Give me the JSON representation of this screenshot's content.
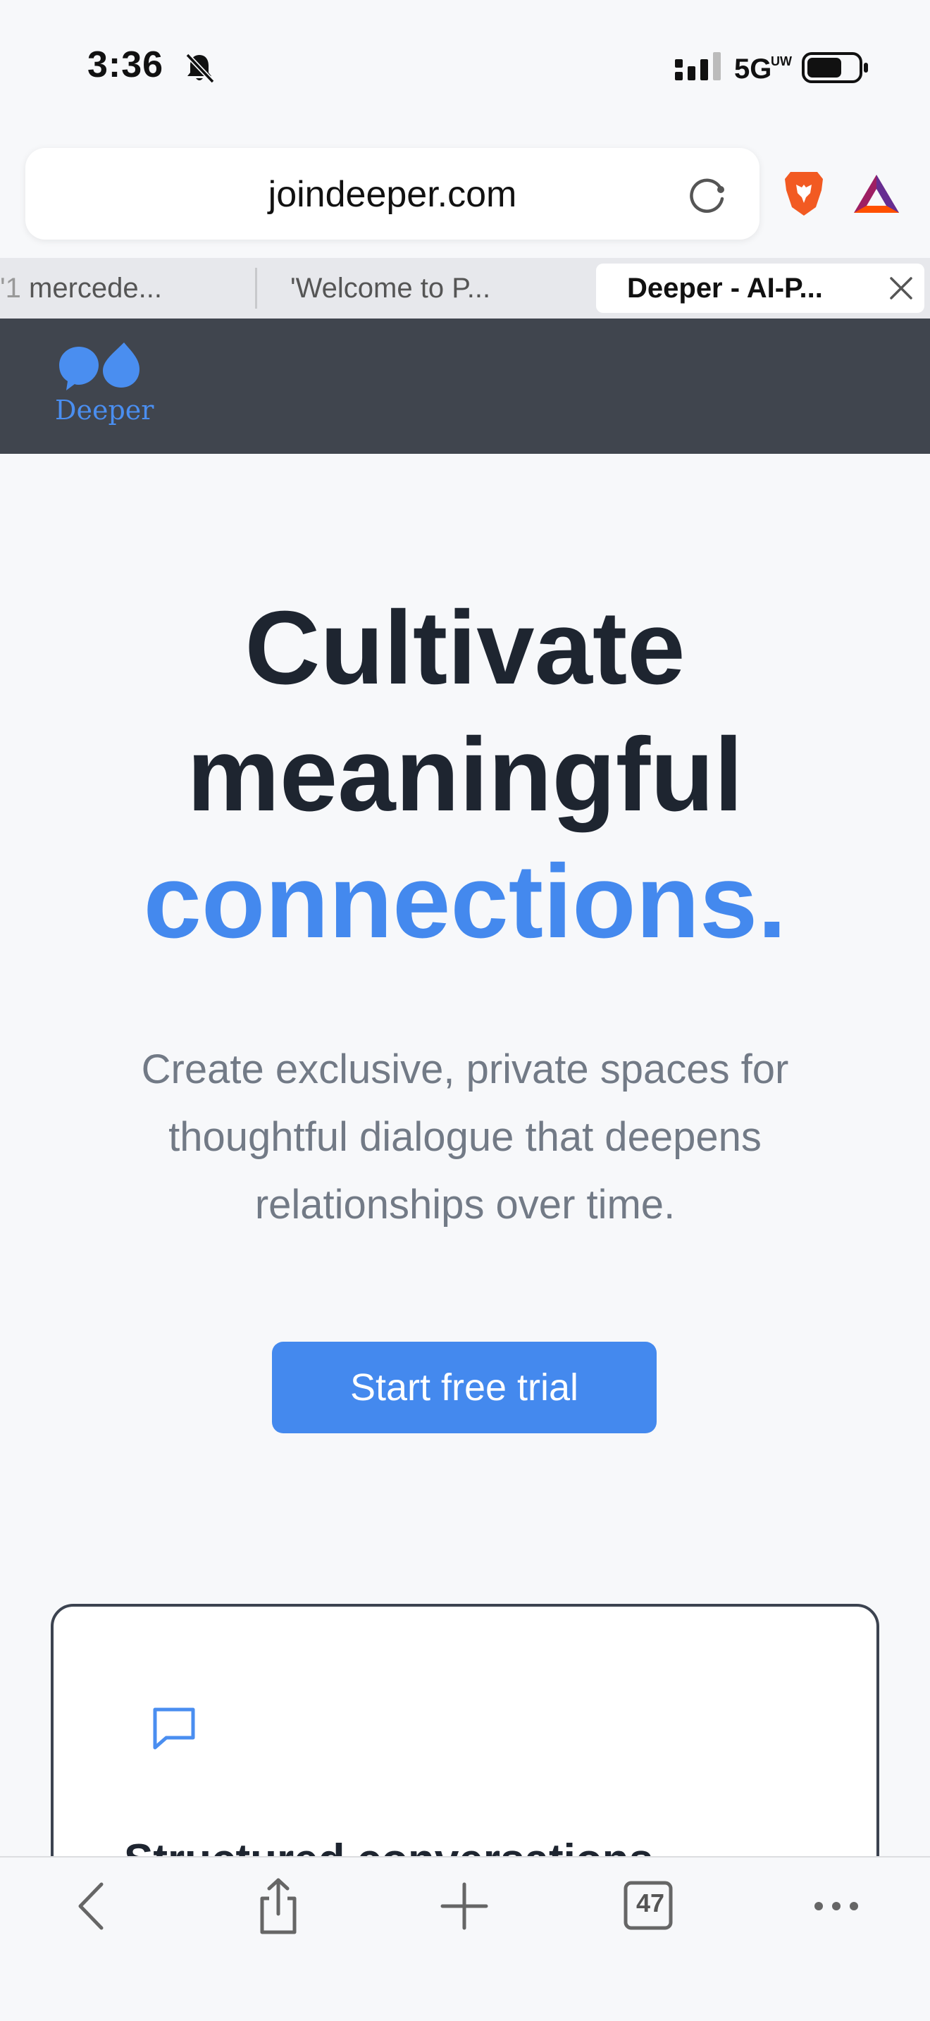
{
  "status_bar": {
    "time": "3:36",
    "network": "5G",
    "network_sub": "UW"
  },
  "browser": {
    "url": "joindeeper.com",
    "tabs": [
      {
        "label_faded": "'1 ",
        "label": "mercede..."
      },
      {
        "label": "'Welcome to P..."
      },
      {
        "label": "Deeper - AI-P...",
        "active": true
      }
    ],
    "tab_count": "47"
  },
  "site": {
    "logo_text": "Deeper",
    "hero": {
      "line1": "Cultivate",
      "line2": "meaningful",
      "line3": "connections."
    },
    "subtitle": "Create exclusive, private spaces for thoughtful dialogue that deepens relationships over time.",
    "cta_label": "Start free trial",
    "feature_card": {
      "icon": "chat-bubble-icon",
      "title": "Structured conversations"
    }
  },
  "colors": {
    "accent": "#4489ee",
    "header_bg": "#40454e",
    "heading": "#1e2530",
    "body_text": "#727a86"
  }
}
